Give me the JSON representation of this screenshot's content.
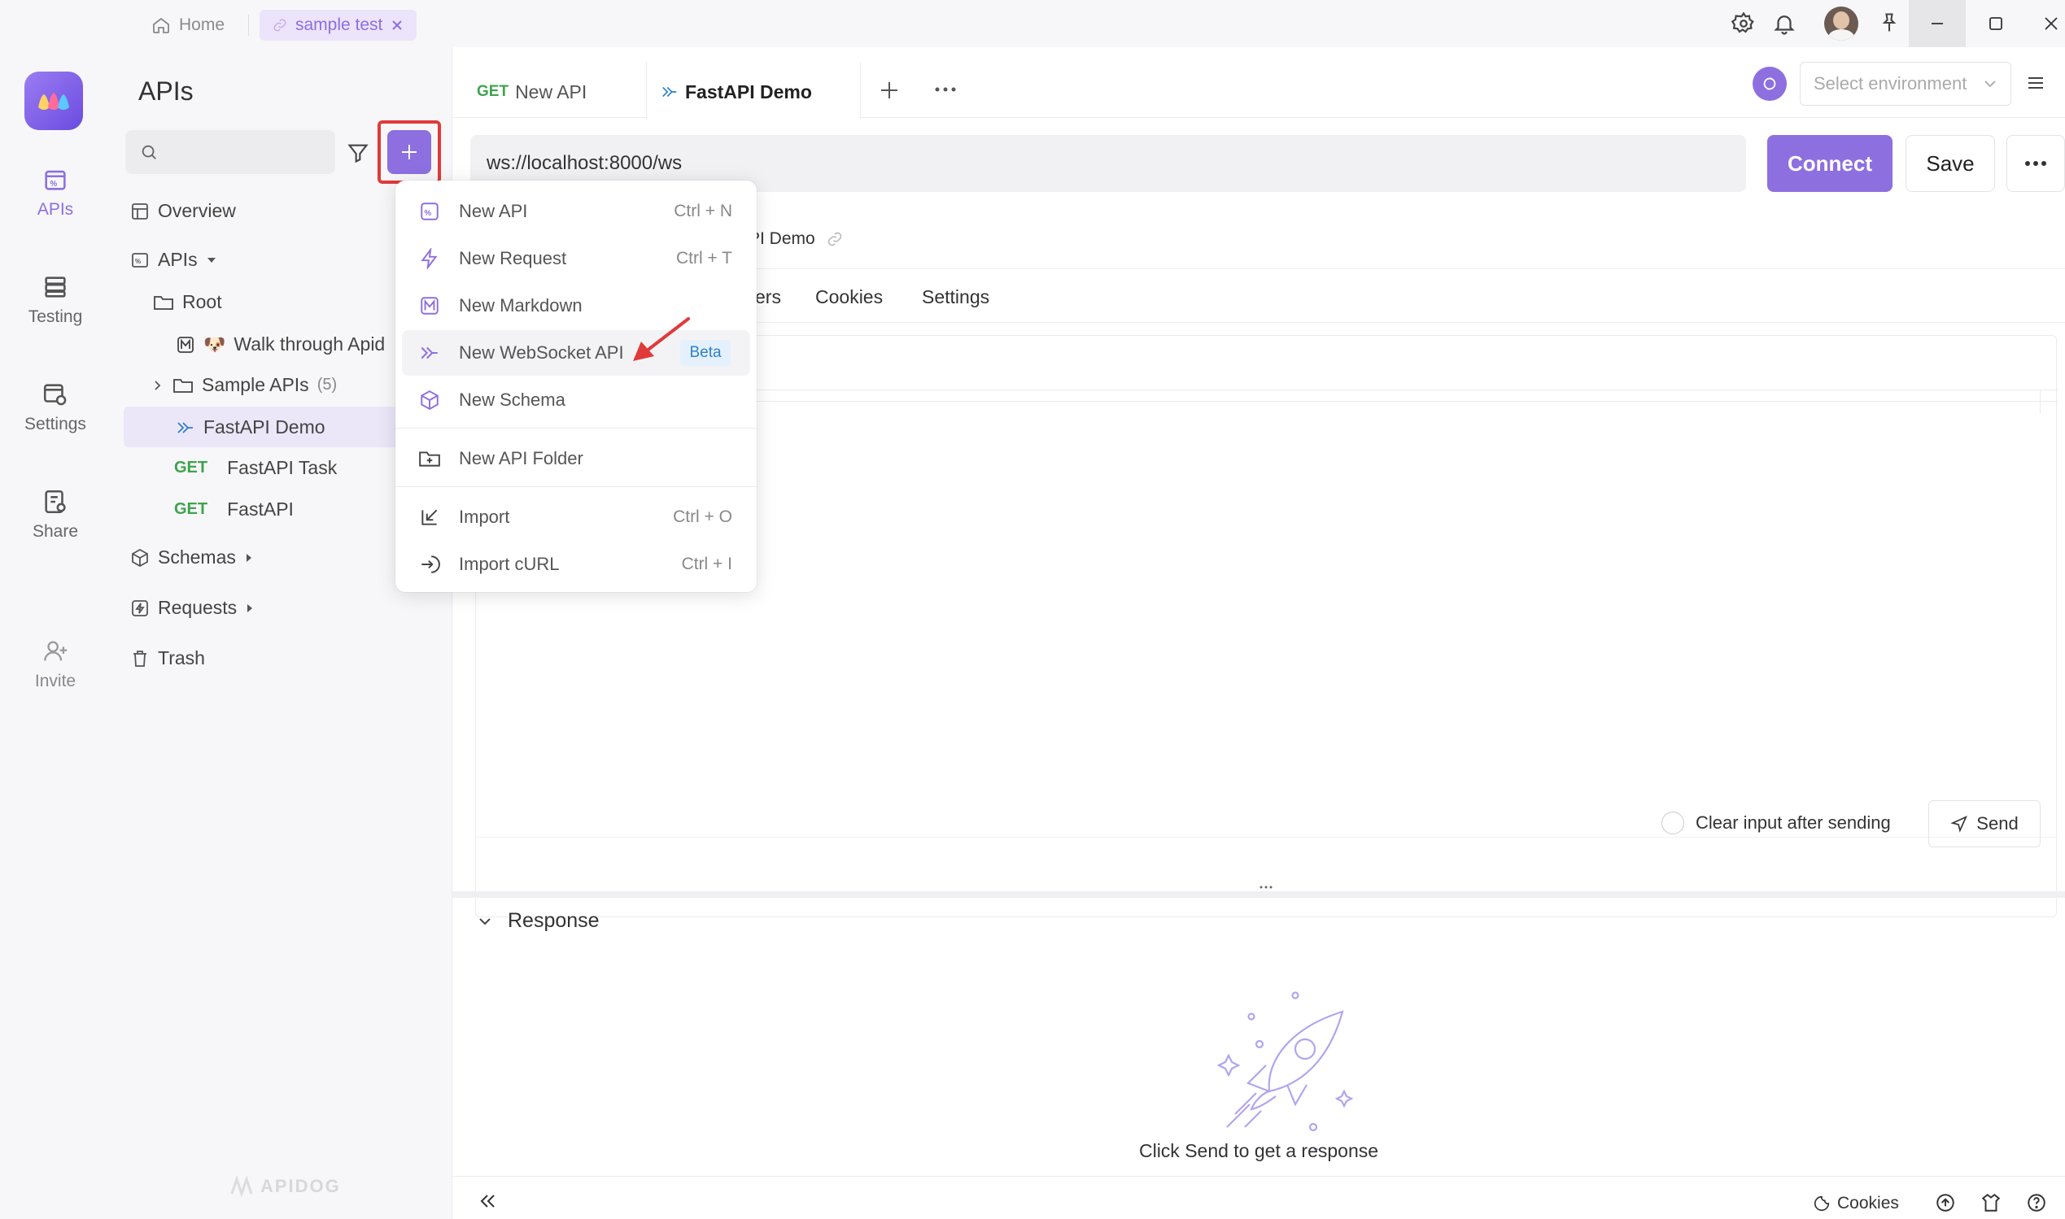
{
  "titlebar": {
    "home_label": "Home",
    "active_tab_label": "sample test"
  },
  "rail": {
    "apis": "APIs",
    "testing": "Testing",
    "settings": "Settings",
    "share": "Share",
    "invite": "Invite"
  },
  "tree": {
    "title": "APIs",
    "overview": "Overview",
    "apis_group": "APIs",
    "root": "Root",
    "walkthrough": "Walk through Apid",
    "sample_apis": "Sample APIs",
    "sample_apis_count": "(5)",
    "fastapi_demo": "FastAPI Demo",
    "get_method": "GET",
    "fastapi_task": "FastAPI Task",
    "fastapi": "FastAPI",
    "schemas": "Schemas",
    "requests": "Requests",
    "trash": "Trash",
    "watermark": "APIDOG"
  },
  "tabs": {
    "tab1_method": "GET",
    "tab1_label": "New API",
    "tab2_label": "FastAPI Demo"
  },
  "env": {
    "placeholder": "Select environment"
  },
  "url_bar": {
    "value": "ws://localhost:8000/ws",
    "connect_label": "Connect",
    "save_label": "Save"
  },
  "breadcrumb": {
    "partial": "PI Demo"
  },
  "subtabs": {
    "partial": "ers",
    "cookies": "Cookies",
    "settings": "Settings"
  },
  "message": {
    "clear_label": "Clear input after sending",
    "send_label": "Send"
  },
  "response": {
    "title": "Response",
    "empty_text": "Click Send to get a response"
  },
  "footer": {
    "cookies": "Cookies"
  },
  "menu": {
    "items": [
      {
        "label": "New API",
        "shortcut": "Ctrl + N",
        "icon": "api-icon"
      },
      {
        "label": "New Request",
        "shortcut": "Ctrl + T",
        "icon": "lightning-icon"
      },
      {
        "label": "New Markdown",
        "shortcut": "",
        "icon": "markdown-icon"
      },
      {
        "label": "New WebSocket API",
        "badge": "Beta",
        "icon": "websocket-icon"
      },
      {
        "label": "New Schema",
        "shortcut": "",
        "icon": "cube-icon"
      },
      {
        "label": "New API Folder",
        "shortcut": "",
        "icon": "folder-plus-icon"
      },
      {
        "label": "Import",
        "shortcut": "Ctrl + O",
        "icon": "import-icon"
      },
      {
        "label": "Import cURL",
        "shortcut": "Ctrl + I",
        "icon": "import-curl-icon"
      }
    ]
  },
  "colors": {
    "accent": "#8d6fe0",
    "get_green": "#3fa34d",
    "highlight_red": "#e03a3a"
  }
}
